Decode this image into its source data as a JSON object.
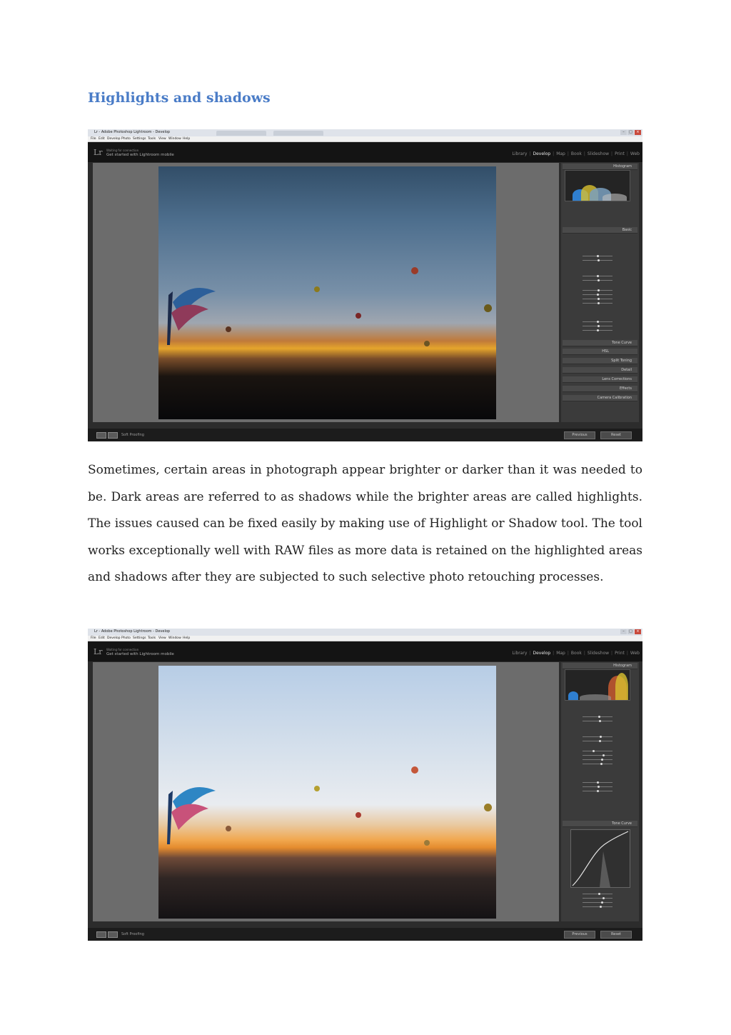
{
  "document": {
    "heading": "Highlights and shadows",
    "paragraph": "Sometimes, certain areas in photograph appear brighter or darker than it was needed to be. Dark areas are referred to as shadows while the brighter areas are called highlights. The issues caused can be fixed easily by making use of Highlight or Shadow tool. The tool works exceptionally well with RAW files as more data is retained on the highlighted areas and shadows after they are subjected to such selective photo retouching processes."
  },
  "app": {
    "window_title": "Lr - Adobe Photoshop Lightroom - Develop",
    "logo": "Lr",
    "identity_line1": "Waiting for connection",
    "identity_line2": "Get started with Lightroom mobile",
    "menu": [
      "File",
      "Edit",
      "Develop",
      "Photo",
      "Settings",
      "Tools",
      "View",
      "Window",
      "Help"
    ],
    "modules": [
      "Library",
      "Develop",
      "Map",
      "Book",
      "Slideshow",
      "Print",
      "Web"
    ],
    "active_module": "Develop",
    "soft_proofing": "Soft Proofing",
    "previous_button": "Previous",
    "reset_button": "Reset"
  },
  "screenshot1": {
    "panels": [
      "Histogram",
      "Basic",
      "Tone Curve",
      "HSL",
      "Split Toning",
      "Detail",
      "Lens Corrections",
      "Effects",
      "Camera Calibration"
    ]
  },
  "screenshot2": {
    "panels": [
      "Histogram",
      "Tone Curve"
    ]
  }
}
